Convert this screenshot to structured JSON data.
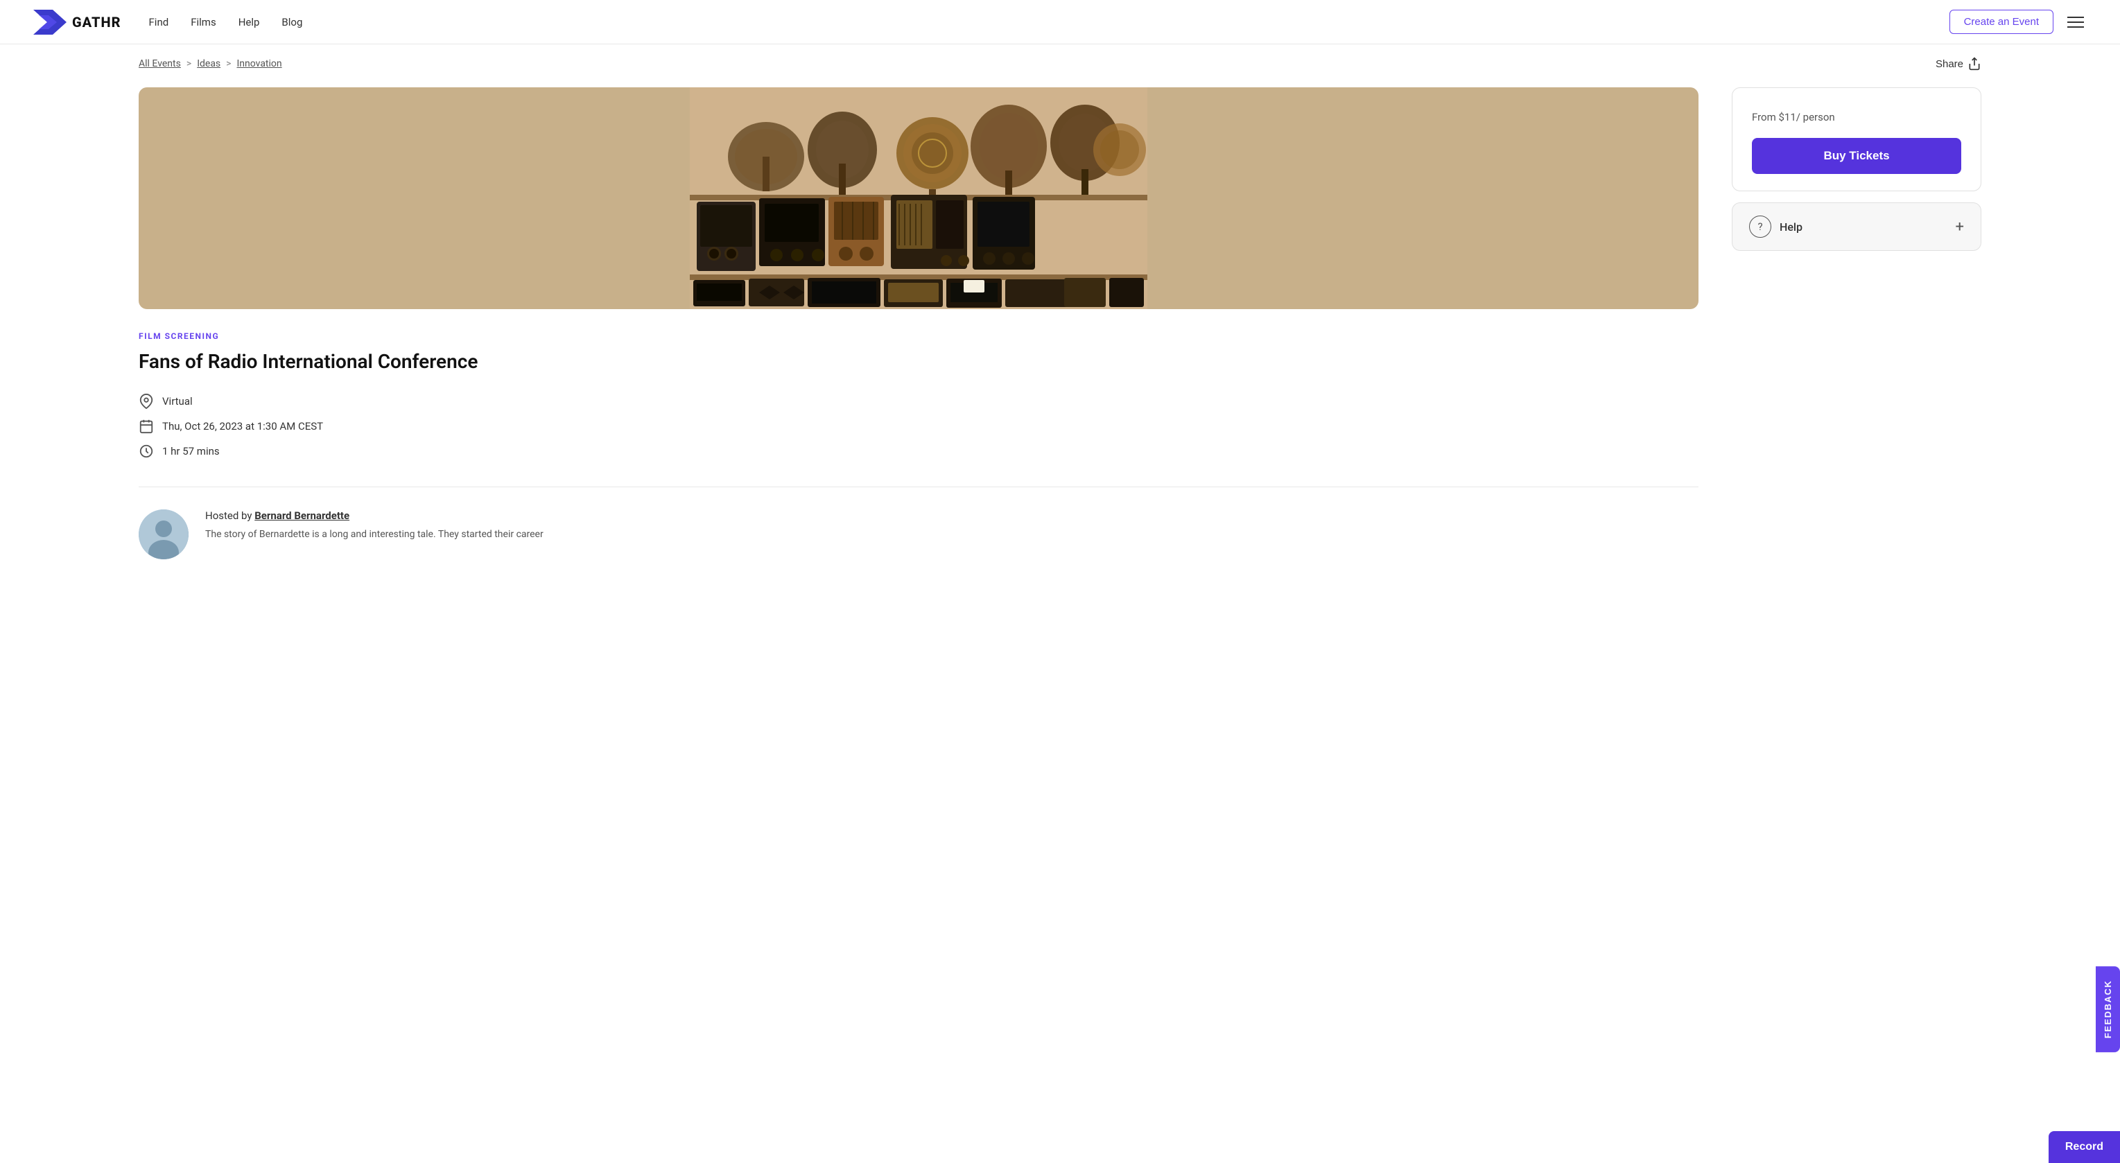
{
  "header": {
    "logo_text": "GATHR",
    "nav": [
      {
        "label": "Find",
        "href": "#"
      },
      {
        "label": "Films",
        "href": "#"
      },
      {
        "label": "Help",
        "href": "#"
      },
      {
        "label": "Blog",
        "href": "#"
      }
    ],
    "create_event_label": "Create an Event",
    "hamburger_aria": "Open menu"
  },
  "breadcrumb": {
    "all_events": "All Events",
    "ideas": "Ideas",
    "innovation": "Innovation",
    "share_label": "Share"
  },
  "event": {
    "category": "FILM SCREENING",
    "title": "Fans of Radio International Conference",
    "location": "Virtual",
    "date": "Thu, Oct 26, 2023 at 1:30 AM CEST",
    "duration": "1 hr 57 mins",
    "price_from": "From $11",
    "price_per": "/ person",
    "buy_tickets": "Buy Tickets",
    "help_label": "Help"
  },
  "host": {
    "hosted_by_label": "Hosted by",
    "host_name": "Bernard Bernardette",
    "description": "The story of Bernardette is a long and interesting tale. They started their career"
  },
  "feedback": {
    "label": "FEEDBACK"
  },
  "record": {
    "label": "Record"
  }
}
